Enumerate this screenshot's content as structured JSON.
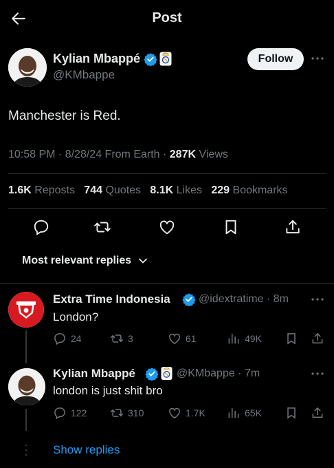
{
  "header": {
    "title": "Post",
    "back_icon": "arrow-left-icon"
  },
  "post": {
    "author_name": "Kylian Mbappé",
    "author_handle": "@KMbappe",
    "follow_label": "Follow",
    "text": "Manchester is Red.",
    "time": "10:58 PM",
    "date": "8/28/24",
    "source": "From Earth",
    "views_count": "287K",
    "views_label": "Views",
    "stats": {
      "reposts_count": "1.6K",
      "reposts_label": "Reposts",
      "quotes_count": "744",
      "quotes_label": "Quotes",
      "likes_count": "8.1K",
      "likes_label": "Likes",
      "bookmarks_count": "229",
      "bookmarks_label": "Bookmarks"
    },
    "actions": [
      "reply-icon",
      "repost-icon",
      "like-icon",
      "bookmark-icon",
      "share-icon"
    ]
  },
  "replies_sort": {
    "label": "Most relevant replies"
  },
  "replies": [
    {
      "author_name": "Extra Time Indonesia",
      "handle_time": "@idextratime · 8m",
      "text": "London?",
      "reply_count": "24",
      "repost_count": "3",
      "like_count": "61",
      "view_count": "49K",
      "avatar_color": "#d71920"
    },
    {
      "author_name": "Kylian Mbappé",
      "handle_time": "@KMbappe · 7m",
      "text": "london is just shit bro",
      "reply_count": "122",
      "repost_count": "310",
      "like_count": "1.7K",
      "view_count": "65K"
    }
  ],
  "show_replies_label": "Show replies",
  "colors": {
    "background": "#000000",
    "text": "#e7e9ea",
    "muted": "#71767b",
    "accent": "#1d9bf0",
    "divider": "#2f3336"
  }
}
